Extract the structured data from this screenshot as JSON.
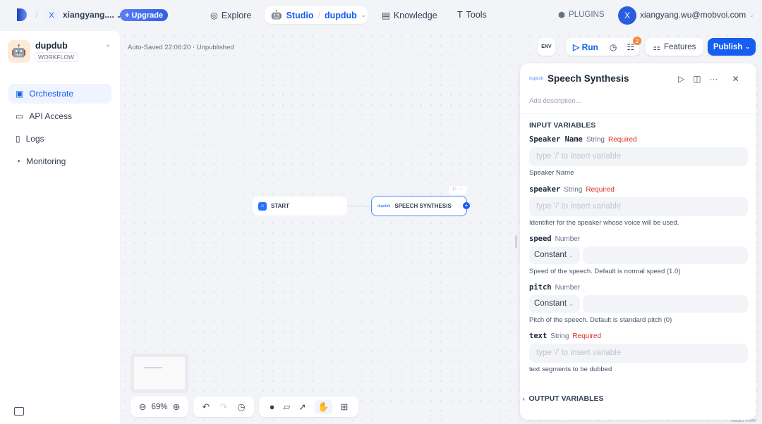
{
  "topbar": {
    "workspace_initial": "X",
    "workspace_name": "xiangyang....",
    "upgrade": "+ Upgrade",
    "explore": "Explore",
    "studio": "Studio",
    "app": "dupdub",
    "knowledge": "Knowledge",
    "tools": "Tools",
    "plugins": "PLUGINS",
    "user_initial": "X",
    "user_email": "xiangyang.wu@mobvoi.com"
  },
  "sidebar": {
    "app_name": "dupdub",
    "app_type": "WORKFLOW",
    "items": [
      {
        "label": "Orchestrate"
      },
      {
        "label": "API Access"
      },
      {
        "label": "Logs"
      },
      {
        "label": "Monitoring"
      }
    ]
  },
  "canvas": {
    "status": "Auto-Saved 22:06:20 · Unpublished",
    "env": "ENV",
    "run": "Run",
    "badge": "2",
    "features": "Features",
    "publish": "Publish",
    "zoom": "69%",
    "nodes": {
      "start": "START",
      "speech": "SPEECH SYNTHESIS"
    },
    "attribution": "React Flow"
  },
  "panel": {
    "logo": "dupdub",
    "title": "Speech Synthesis",
    "description_placeholder": "Add description...",
    "input_header": "INPUT VARIABLES",
    "output_header": "OUTPUT VARIABLES",
    "vars": [
      {
        "name": "Speaker Name",
        "type": "String",
        "required": "Required",
        "placeholder": "type '/' to insert variable",
        "hint": "Speaker Name"
      },
      {
        "name": "speaker",
        "type": "String",
        "required": "Required",
        "placeholder": "type '/' to insert variable",
        "hint": "Identifier for the speaker whose voice will be used."
      },
      {
        "name": "speed",
        "type": "Number",
        "mode": "Constant",
        "hint": "Speed of the speech. Default is normal speed (1.0)"
      },
      {
        "name": "pitch",
        "type": "Number",
        "mode": "Constant",
        "hint": "Pitch of the speech. Default is standard pitch (0)"
      },
      {
        "name": "text",
        "type": "String",
        "required": "Required",
        "placeholder": "type '/' to insert variable",
        "hint": "text segments to be dubbed"
      }
    ]
  }
}
